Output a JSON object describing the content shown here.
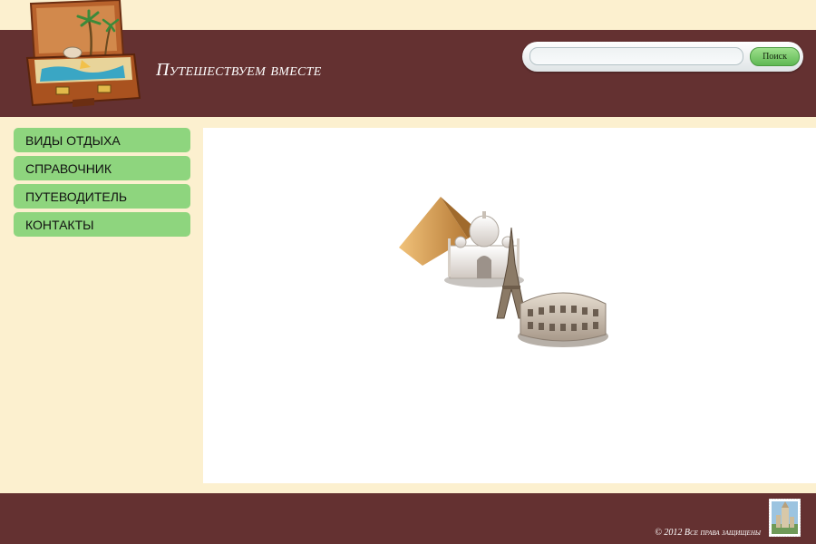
{
  "header": {
    "site_title": "Путешествуем вместе",
    "logo_icon": "suitcase-beach-icon"
  },
  "search": {
    "value": "",
    "placeholder": "",
    "button_label": "Поиск"
  },
  "sidebar": {
    "items": [
      {
        "label": "Виды отдыха"
      },
      {
        "label": "Справочник"
      },
      {
        "label": "Путеводитель"
      },
      {
        "label": "Контакты"
      }
    ]
  },
  "main": {
    "illustration": "world-landmarks-icon"
  },
  "footer": {
    "copyright": "© 2012 Все права защищены",
    "stamp_icon": "postage-stamp-icon"
  },
  "colors": {
    "background": "#fcf0cf",
    "brand": "#643131",
    "nav": "#8ed57e",
    "search_button": "#6cc05e"
  }
}
